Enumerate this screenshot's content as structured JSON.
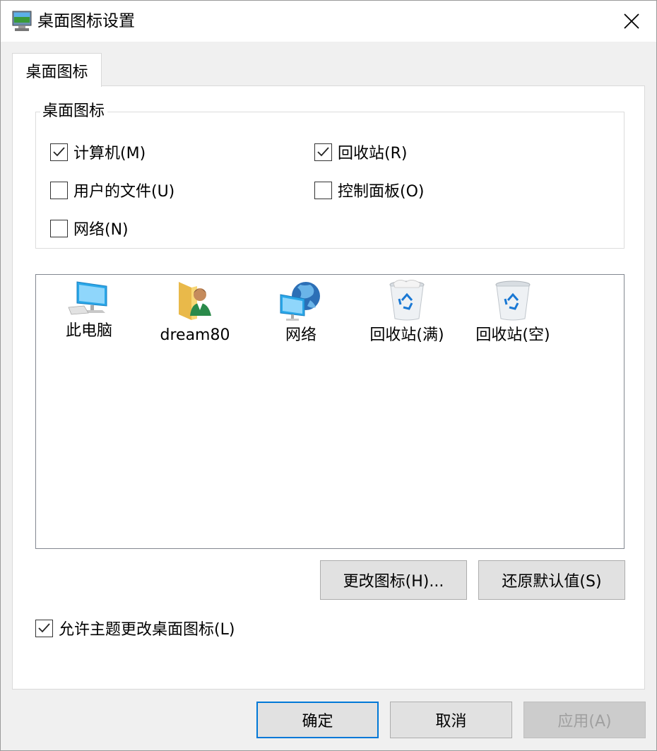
{
  "window": {
    "title": "桌面图标设置"
  },
  "tab": {
    "label": "桌面图标"
  },
  "group": {
    "title": "桌面图标",
    "options": [
      {
        "label": "计算机(M)",
        "checked": true
      },
      {
        "label": "回收站(R)",
        "checked": true
      },
      {
        "label": "用户的文件(U)",
        "checked": false
      },
      {
        "label": "控制面板(O)",
        "checked": false
      },
      {
        "label": "网络(N)",
        "checked": false
      }
    ]
  },
  "icons": [
    {
      "label": "此电脑",
      "icon": "computer-icon"
    },
    {
      "label": "dream80",
      "icon": "user-folder-icon"
    },
    {
      "label": "网络",
      "icon": "network-icon"
    },
    {
      "label": "回收站(满)",
      "icon": "recycle-bin-full-icon"
    },
    {
      "label": "回收站(空)",
      "icon": "recycle-bin-empty-icon"
    }
  ],
  "buttons": {
    "change_icon": "更改图标(H)...",
    "restore_default": "还原默认值(S)",
    "ok": "确定",
    "cancel": "取消",
    "apply": "应用(A)"
  },
  "allow_theme": {
    "label": "允许主题更改桌面图标(L)",
    "checked": true
  },
  "colors": {
    "accent": "#0078d7",
    "folder": "#f8d775",
    "monitor": "#2aa7e8"
  }
}
